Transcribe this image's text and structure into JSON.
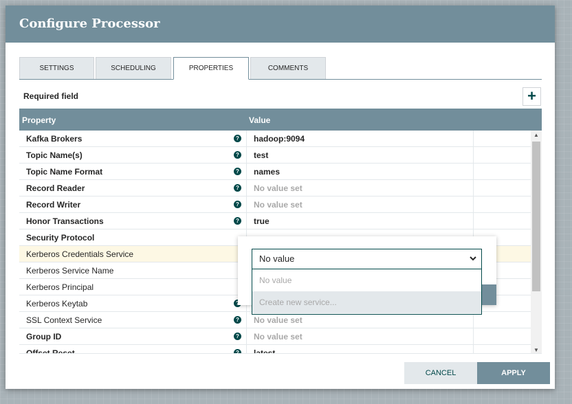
{
  "dialog": {
    "title": "Configure Processor"
  },
  "tabs": [
    {
      "label": "SETTINGS",
      "active": false
    },
    {
      "label": "SCHEDULING",
      "active": false
    },
    {
      "label": "PROPERTIES",
      "active": true
    },
    {
      "label": "COMMENTS",
      "active": false
    }
  ],
  "required_label": "Required field",
  "add_button_symbol": "+",
  "table": {
    "headers": {
      "property": "Property",
      "value": "Value"
    },
    "rows": [
      {
        "name": "Kafka Brokers",
        "value": "hadoop:9094",
        "required": true,
        "help": true
      },
      {
        "name": "Topic Name(s)",
        "value": "test",
        "required": true,
        "help": true
      },
      {
        "name": "Topic Name Format",
        "value": "names",
        "required": true,
        "help": true
      },
      {
        "name": "Record Reader",
        "value": "No value set",
        "required": true,
        "help": true
      },
      {
        "name": "Record Writer",
        "value": "No value set",
        "required": true,
        "help": true
      },
      {
        "name": "Honor Transactions",
        "value": "true",
        "required": true,
        "help": true
      },
      {
        "name": "Security Protocol",
        "value": "",
        "required": true,
        "help": false
      },
      {
        "name": "Kerberos Credentials Service",
        "value": "",
        "required": false,
        "help": false
      },
      {
        "name": "Kerberos Service Name",
        "value": "",
        "required": false,
        "help": false
      },
      {
        "name": "Kerberos Principal",
        "value": "",
        "required": false,
        "help": false
      },
      {
        "name": "Kerberos Keytab",
        "value": "",
        "required": false,
        "help": true
      },
      {
        "name": "SSL Context Service",
        "value": "No value set",
        "required": false,
        "help": true
      },
      {
        "name": "Group ID",
        "value": "No value set",
        "required": true,
        "help": true
      },
      {
        "name": "Offset Reset",
        "value": "latest",
        "required": true,
        "help": true
      }
    ]
  },
  "dropdown": {
    "selected": "No value",
    "options": [
      "No value",
      "Create new service..."
    ]
  },
  "footer": {
    "cancel": "CANCEL",
    "apply": "APPLY"
  },
  "icons": {
    "help": "help-circle-icon",
    "chevron": "chevron-down-icon",
    "add": "plus-icon"
  },
  "colors": {
    "header": "#728e9b",
    "accent": "#004849",
    "highlight_row": "#fdf8e4"
  }
}
